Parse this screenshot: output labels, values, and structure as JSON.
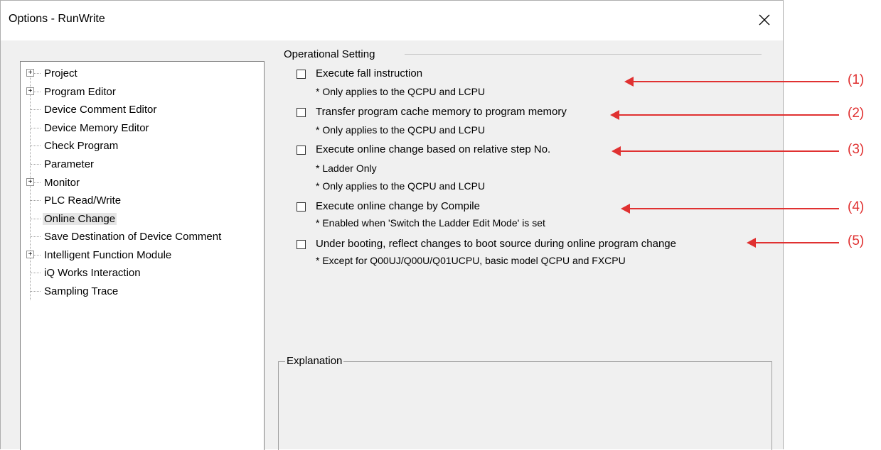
{
  "window": {
    "title": "Options - RunWrite",
    "close_glyph": "✕"
  },
  "tree": {
    "items": [
      {
        "label": "Project",
        "expandable": true
      },
      {
        "label": "Program Editor",
        "expandable": true
      },
      {
        "label": "Device Comment Editor",
        "expandable": false
      },
      {
        "label": "Device Memory Editor",
        "expandable": false
      },
      {
        "label": "Check Program",
        "expandable": false
      },
      {
        "label": "Parameter",
        "expandable": false
      },
      {
        "label": "Monitor",
        "expandable": true
      },
      {
        "label": "PLC Read/Write",
        "expandable": false
      },
      {
        "label": "Online Change",
        "expandable": false,
        "selected": true
      },
      {
        "label": "Save Destination of Device Comment",
        "expandable": false
      },
      {
        "label": "Intelligent Function Module",
        "expandable": true
      },
      {
        "label": "iQ Works Interaction",
        "expandable": false
      },
      {
        "label": "Sampling Trace",
        "expandable": false
      }
    ],
    "expander_glyph": "+"
  },
  "operational": {
    "group_label": "Operational Setting",
    "options": [
      {
        "label": "Execute fall instruction",
        "checked": false,
        "notes": [
          "* Only applies to the QCPU and LCPU"
        ],
        "callout": "(1)"
      },
      {
        "label": "Transfer program cache memory to program memory",
        "checked": false,
        "notes": [
          "* Only applies to the QCPU and LCPU"
        ],
        "callout": "(2)"
      },
      {
        "label": "Execute online change based on relative step No.",
        "checked": false,
        "notes": [
          "* Ladder Only",
          "* Only applies to the QCPU and LCPU"
        ],
        "callout": "(3)"
      },
      {
        "label": "Execute online change by Compile",
        "checked": false,
        "notes": [
          "* Enabled when 'Switch the Ladder Edit Mode' is set"
        ],
        "callout": "(4)"
      },
      {
        "label": "Under booting, reflect changes to boot source during online program change",
        "checked": false,
        "notes": [
          "* Except for Q00UJ/Q00U/Q01UCPU, basic model QCPU and FXCPU"
        ],
        "callout": "(5)"
      }
    ]
  },
  "explanation": {
    "group_label": "Explanation",
    "text": ""
  },
  "colors": {
    "dialog_bg": "#f0f0f0",
    "annotation_red": "#e03131"
  }
}
